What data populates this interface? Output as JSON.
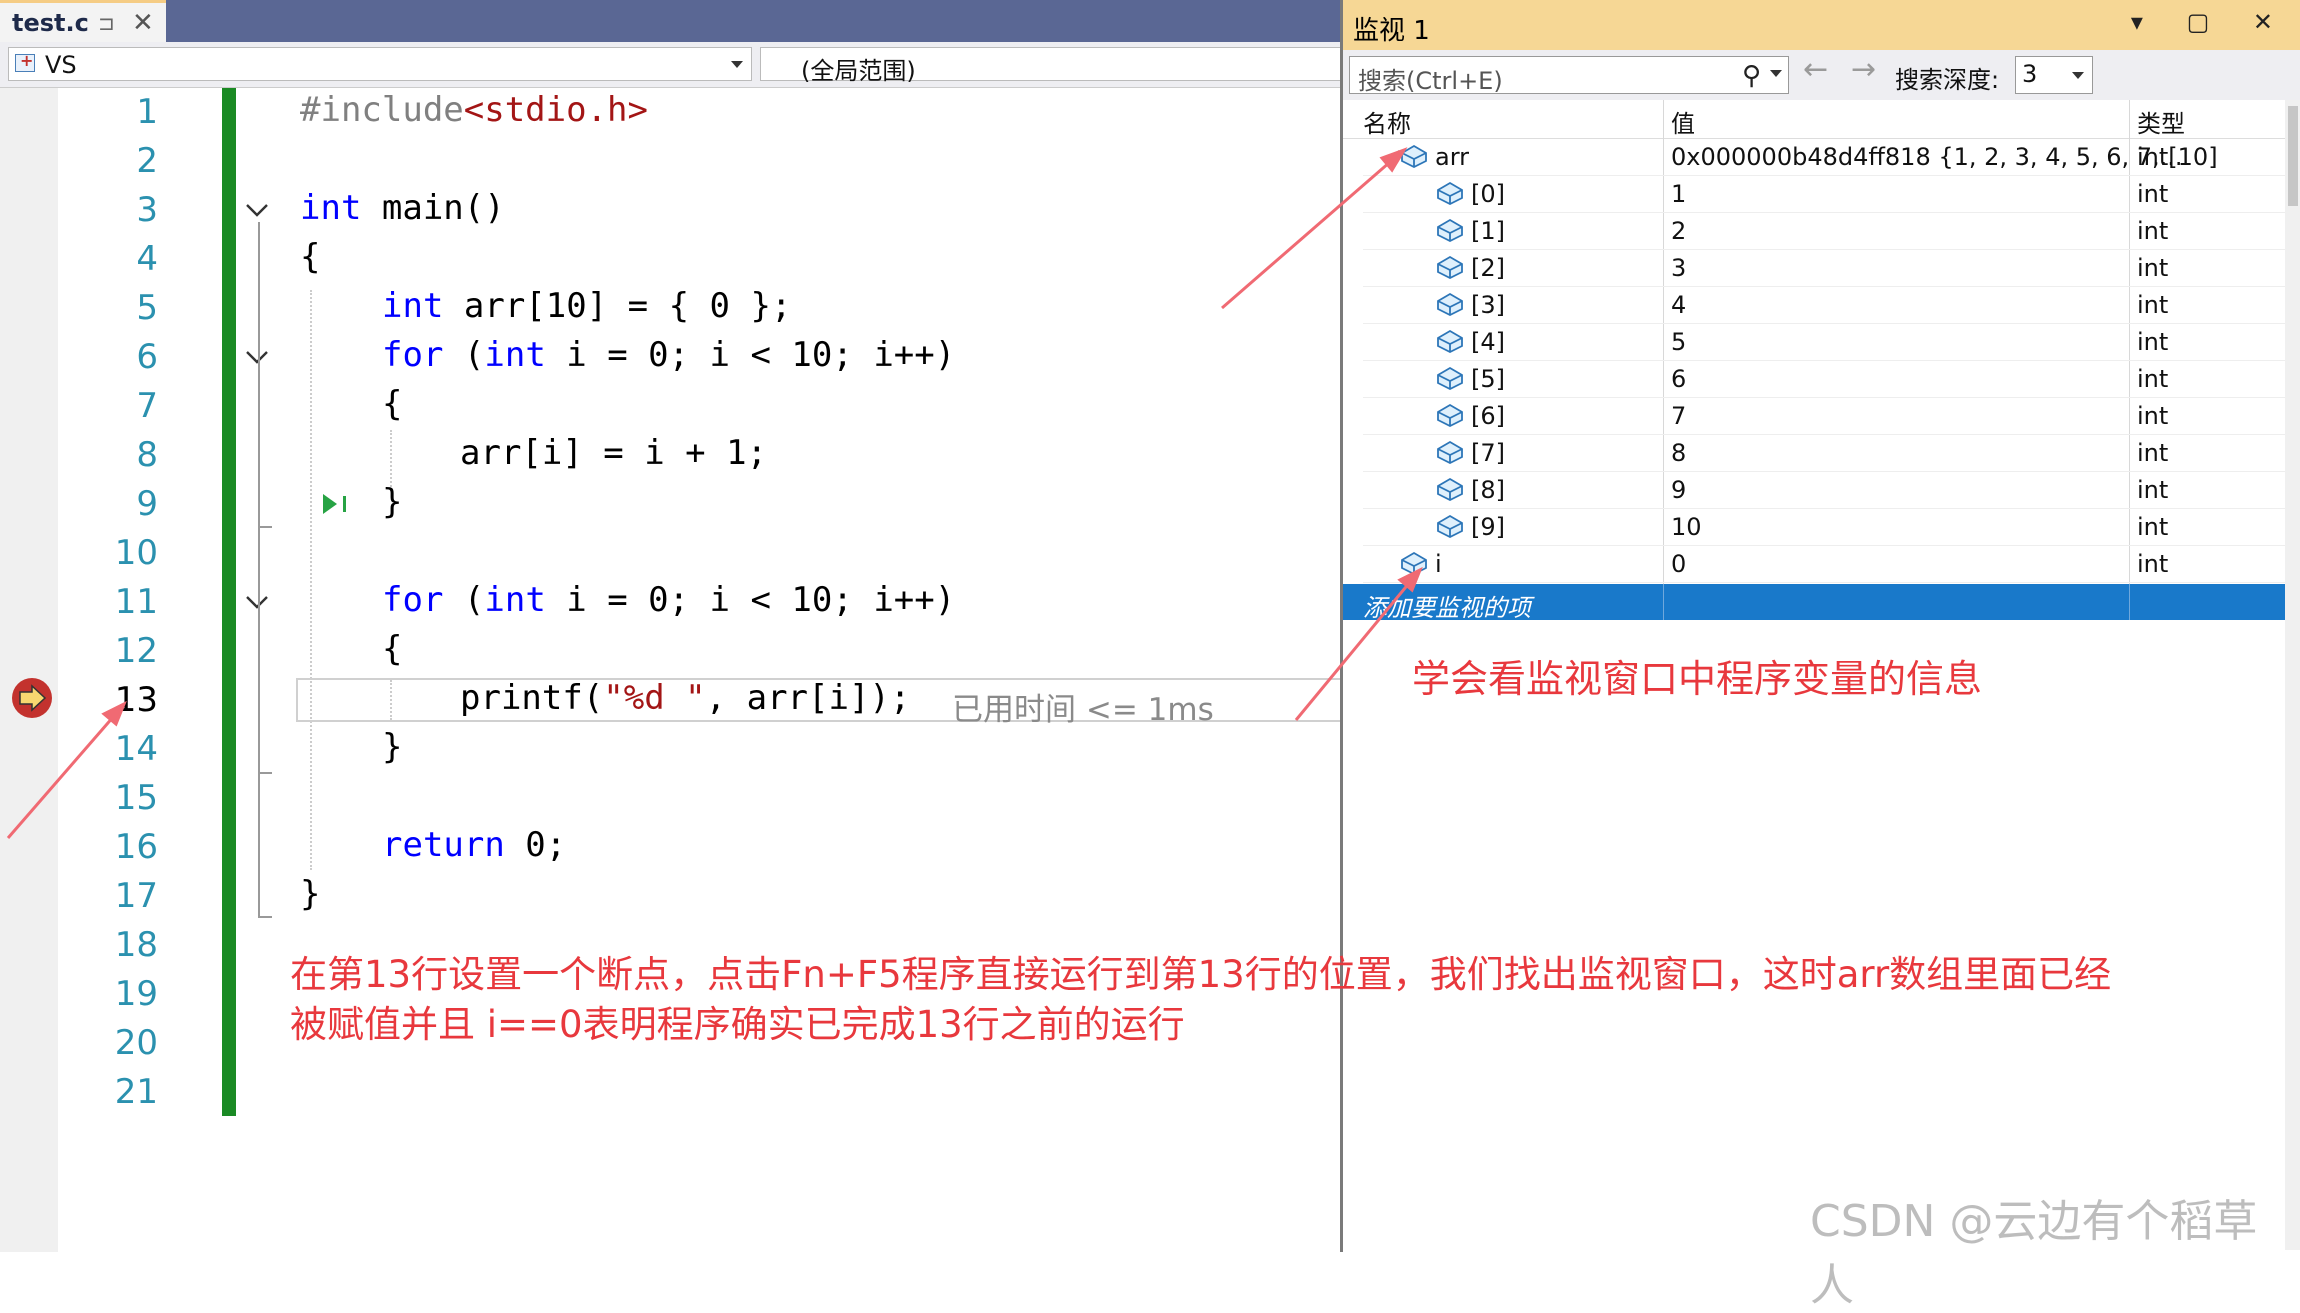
{
  "editor": {
    "tab": {
      "filename": "test.c",
      "pin_glyph": "⊐",
      "close_glyph": "✕"
    },
    "nav": {
      "project": "VS",
      "scope": "(全局范围)"
    },
    "lines": [
      "1",
      "2",
      "3",
      "4",
      "5",
      "6",
      "7",
      "8",
      "9",
      "10",
      "11",
      "12",
      "13",
      "14",
      "15",
      "16",
      "17",
      "18",
      "19",
      "20",
      "21"
    ],
    "current_line": "13",
    "code": {
      "l1": {
        "a": "#include",
        "b": "<stdio.h>"
      },
      "l3": {
        "kw": "int",
        "rest": " main()"
      },
      "l4": "{",
      "l5": {
        "kw": "int",
        "rest": " arr[10] = { 0 };"
      },
      "l6": {
        "kw": "for",
        "p1": " (",
        "kw2": "int",
        "rest": " i = 0; i < 10; i++)"
      },
      "l7": "{",
      "l8": "arr[i] = i + 1;",
      "l9": "}",
      "l11": {
        "kw": "for",
        "p1": " (",
        "kw2": "int",
        "rest": " i = 0; i < 10; i++)"
      },
      "l12": "{",
      "l13": {
        "a": "printf(",
        "s": "\"%d \"",
        "rest": ", arr[i]);"
      },
      "l14": "}",
      "l16": {
        "kw": "return",
        "rest": " 0;"
      },
      "l17": "}"
    },
    "elapsed": "已用时间 <= 1ms"
  },
  "watch": {
    "title": "监视 1",
    "title_buttons": "▾ ▢ ✕",
    "search_placeholder": "搜索(Ctrl+E)",
    "search_icon_glyph": "⚲",
    "back_glyph": "←",
    "forward_glyph": "→",
    "depth_label": "搜索深度:",
    "depth_value": "3",
    "columns": {
      "name": "名称",
      "value": "值",
      "type": "类型"
    },
    "rows": [
      {
        "name": "arr",
        "value": "0x000000b48d4ff818 {1, 2, 3, 4, 5, 6, 7,...",
        "type": "int[10]"
      },
      {
        "name": "[0]",
        "value": "1",
        "type": "int"
      },
      {
        "name": "[1]",
        "value": "2",
        "type": "int"
      },
      {
        "name": "[2]",
        "value": "3",
        "type": "int"
      },
      {
        "name": "[3]",
        "value": "4",
        "type": "int"
      },
      {
        "name": "[4]",
        "value": "5",
        "type": "int"
      },
      {
        "name": "[5]",
        "value": "6",
        "type": "int"
      },
      {
        "name": "[6]",
        "value": "7",
        "type": "int"
      },
      {
        "name": "[7]",
        "value": "8",
        "type": "int"
      },
      {
        "name": "[8]",
        "value": "9",
        "type": "int"
      },
      {
        "name": "[9]",
        "value": "10",
        "type": "int"
      },
      {
        "name": "i",
        "value": "0",
        "type": "int"
      }
    ],
    "add_item": "添加要监视的项"
  },
  "annotations": {
    "watch_note": "学会看监视窗口中程序变量的信息",
    "editor_note_line1": "在第13行设置一个断点，点击Fn+F5程序直接运行到第13行的位置，我们找出监视窗口，这时arr数组里面已经",
    "editor_note_line2": "被赋值并且 i==0表明程序确实已完成13行之前的运行"
  },
  "watermark": "CSDN @云边有个稻草人",
  "colors": {
    "accent_title": "#f6d795",
    "selection": "#1979ca",
    "keyword": "#0000ff",
    "string": "#a31515",
    "line_number": "#2b91af",
    "annotation": "#e8383d",
    "change_bar": "#1a8a24"
  }
}
